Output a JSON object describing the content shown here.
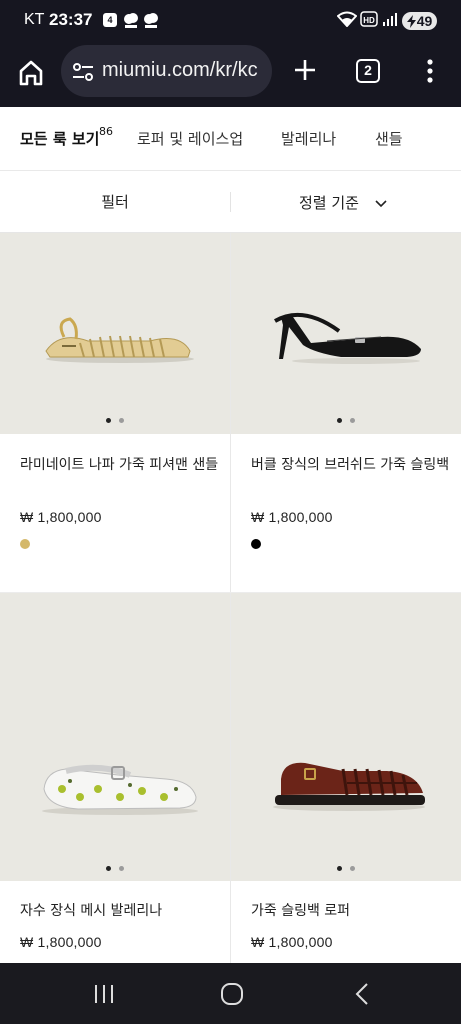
{
  "status_bar": {
    "carrier": "KT",
    "time": "23:37",
    "notification_badge": "4",
    "battery": "49"
  },
  "browser": {
    "url": "miumiu.com/kr/kc",
    "tab_count": "2"
  },
  "category_nav": {
    "items": [
      {
        "label": "모든 룩 보기",
        "count": "86",
        "active": true
      },
      {
        "label": "로퍼 및 레이스업"
      },
      {
        "label": "발레리나"
      },
      {
        "label": "샌들"
      }
    ]
  },
  "filter_bar": {
    "filter_label": "필터",
    "sort_label": "정렬 기준"
  },
  "products": [
    {
      "name": "라미네이트 나파 가죽 피셔맨 샌들",
      "currency": "₩",
      "price": "1,800,000",
      "swatch_color": "#d4b86a",
      "image": "gold-fisherman-sandal"
    },
    {
      "name": "버클 장식의 브러쉬드 가죽 슬링백",
      "currency": "₩",
      "price": "1,800,000",
      "swatch_color": "#000000",
      "image": "black-slingback-pump"
    },
    {
      "name": "자수 장식 메시 발레리나",
      "currency": "₩",
      "price": "1,800,000",
      "image": "embroidered-mesh-ballerina"
    },
    {
      "name": "가죽 슬링백 로퍼",
      "currency": "₩",
      "price": "1,800,000",
      "image": "brown-woven-slingback-loafer"
    }
  ],
  "colors": {
    "browser_chrome": "#161620",
    "product_bg": "#e9e8e2"
  }
}
